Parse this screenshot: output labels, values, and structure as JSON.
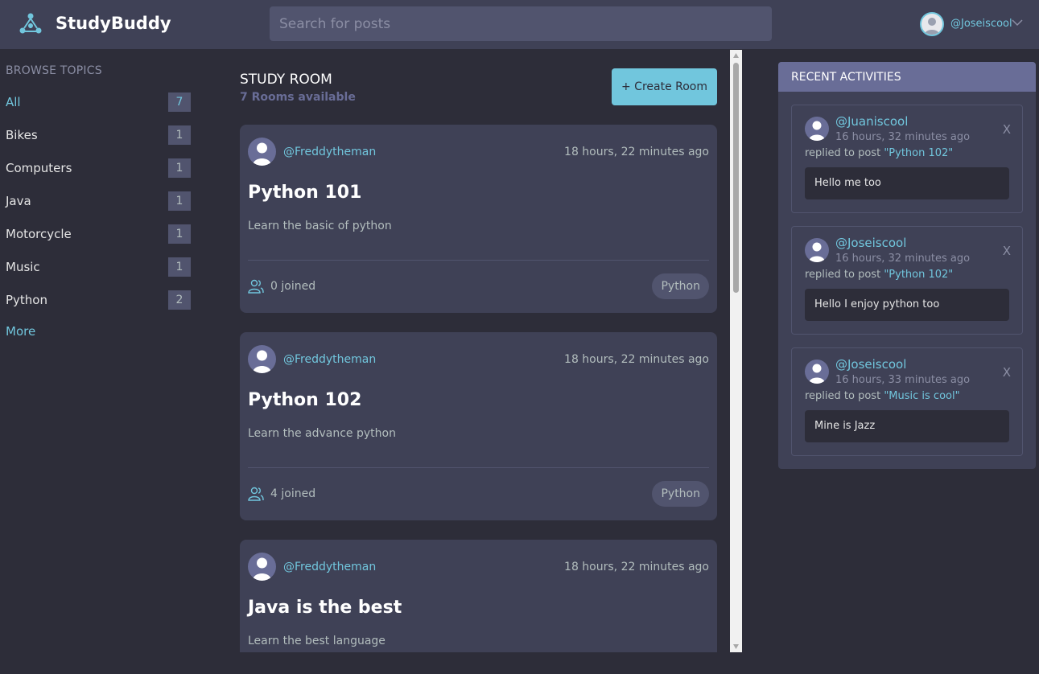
{
  "header": {
    "brand": "StudyBuddy",
    "search_placeholder": "Search for posts",
    "username": "@Joseiscool"
  },
  "sidebar": {
    "heading": "BROWSE TOPICS",
    "topics": [
      {
        "label": "All",
        "count": "7"
      },
      {
        "label": "Bikes",
        "count": "1"
      },
      {
        "label": "Computers",
        "count": "1"
      },
      {
        "label": "Java",
        "count": "1"
      },
      {
        "label": "Motorcycle",
        "count": "1"
      },
      {
        "label": "Music",
        "count": "1"
      },
      {
        "label": "Python",
        "count": "2"
      }
    ],
    "more": "More"
  },
  "main": {
    "title": "STUDY ROOM",
    "subtitle": "7 Rooms available",
    "create_button": "+ Create Room",
    "rooms": [
      {
        "host": "@Freddytheman",
        "time": "18 hours, 22 minutes ago",
        "title": "Python 101",
        "description": "Learn the basic of python",
        "joined": "0 joined",
        "topic": "Python"
      },
      {
        "host": "@Freddytheman",
        "time": "18 hours, 22 minutes ago",
        "title": "Python 102",
        "description": "Learn the advance python",
        "joined": "4 joined",
        "topic": "Python"
      },
      {
        "host": "@Freddytheman",
        "time": "18 hours, 22 minutes ago",
        "title": "Java is the best",
        "description": "Learn the best language",
        "joined": "",
        "topic": ""
      }
    ]
  },
  "activities": {
    "title": "RECENT ACTIVITIES",
    "items": [
      {
        "user": "@Juaniscool",
        "time": "16 hours, 32 minutes ago",
        "replied": "replied to post ",
        "post": "\"Python 102\"",
        "message": "Hello me too",
        "close": "X"
      },
      {
        "user": "@Joseiscool",
        "time": "16 hours, 32 minutes ago",
        "replied": "replied to post ",
        "post": "\"Python 102\"",
        "message": "Hello I enjoy python too",
        "close": "X"
      },
      {
        "user": "@Joseiscool",
        "time": "16 hours, 33 minutes ago",
        "replied": "replied to post ",
        "post": "\"Music is cool\"",
        "message": "Mine is Jazz",
        "close": "X"
      }
    ]
  },
  "colors": {
    "background": "#2d2d39",
    "header": "#3f4156",
    "accent": "#71c6dd",
    "card": "#3f4156",
    "activity_header": "#696d97"
  },
  "icons": [
    "logo-icon",
    "user-avatar",
    "chevron-down-icon",
    "users-icon",
    "scroll-arrow-icon"
  ]
}
